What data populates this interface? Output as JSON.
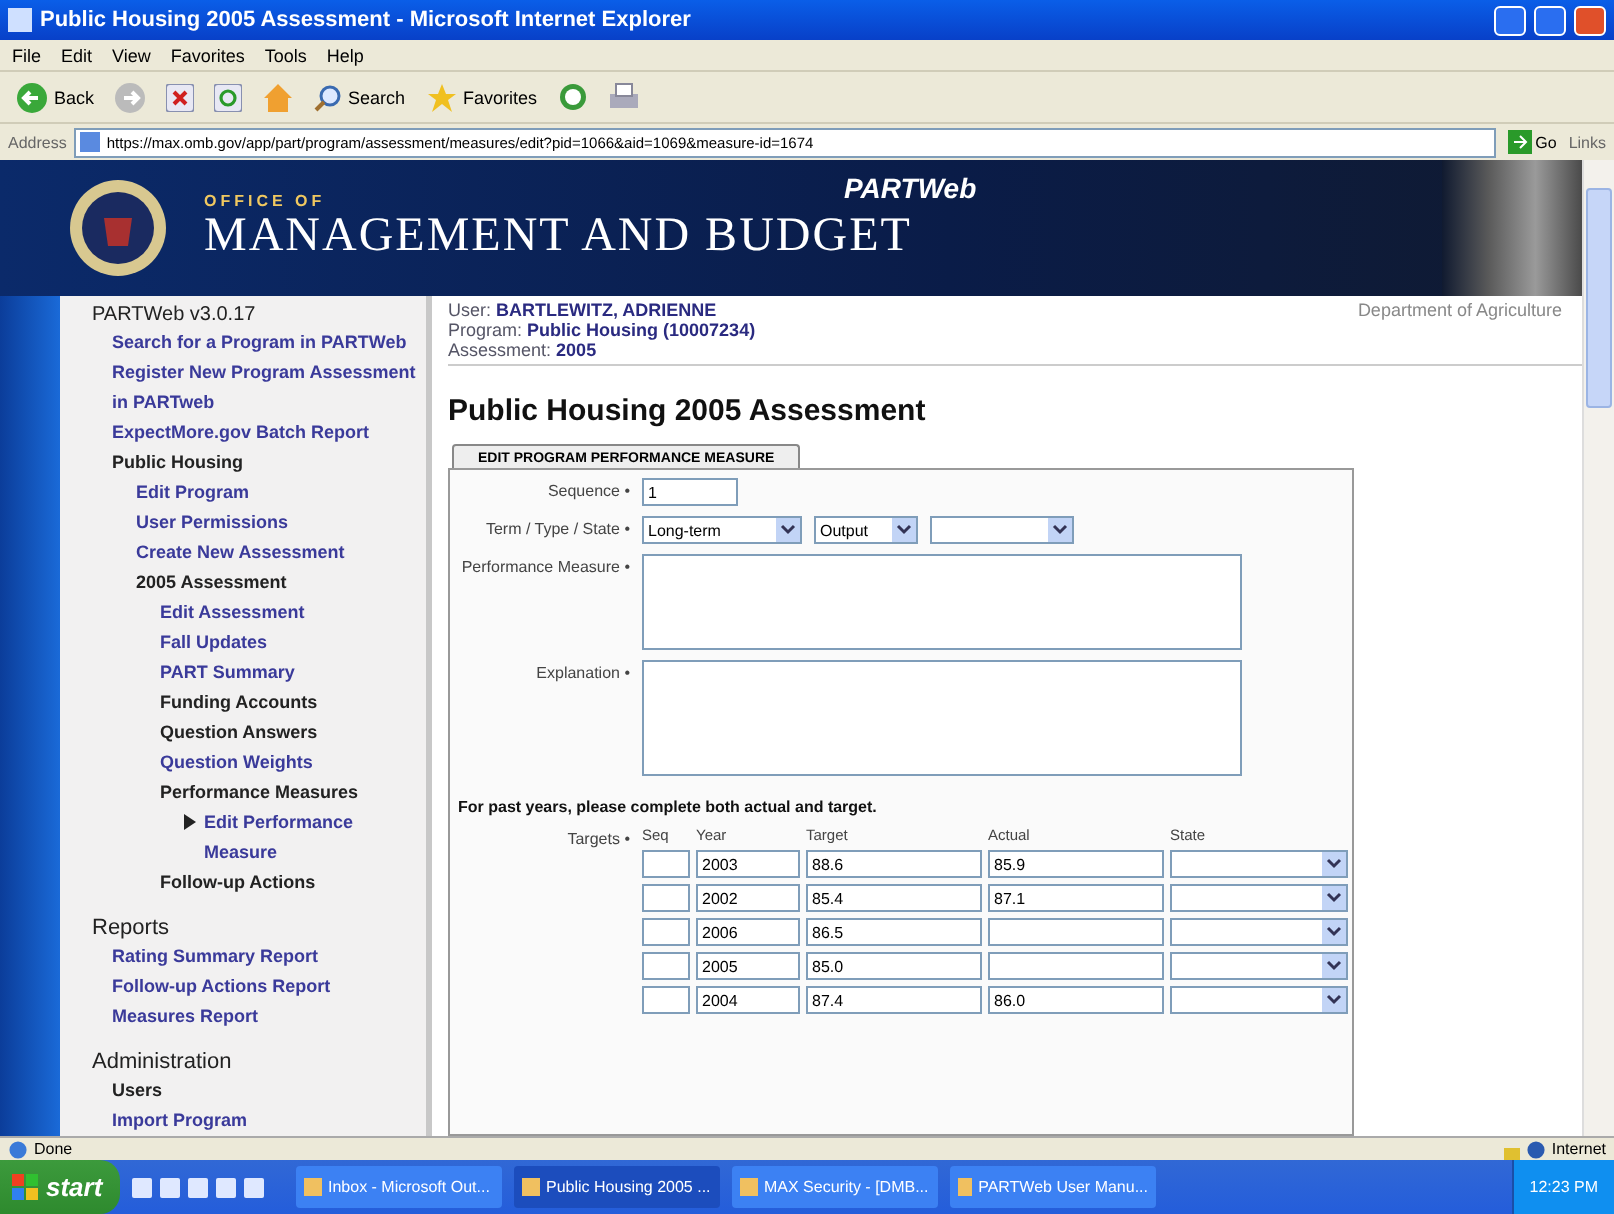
{
  "window": {
    "title": "Public Housing 2005 Assessment - Microsoft Internet Explorer"
  },
  "menu": [
    "File",
    "Edit",
    "View",
    "Favorites",
    "Tools",
    "Help"
  ],
  "toolbar": [
    {
      "kind": "back",
      "label": "Back"
    },
    {
      "kind": "forward"
    },
    {
      "kind": "stop"
    },
    {
      "kind": "refresh"
    },
    {
      "kind": "home"
    },
    {
      "kind": "search",
      "label": "Search"
    },
    {
      "kind": "favorites",
      "label": "Favorites"
    },
    {
      "kind": "history"
    },
    {
      "kind": "print"
    }
  ],
  "address": {
    "label": "Address",
    "url": "https://max.omb.gov/app/part/program/assessment/measures/edit?pid=1066&aid=1069&measure-id=1674",
    "go": "Go",
    "links": "Links"
  },
  "header": {
    "office_of": "OFFICE OF",
    "agency": "MANAGEMENT AND BUDGET",
    "logo": "PARTWeb"
  },
  "sidebar": {
    "sections": [
      {
        "title": "PARTWeb v3.0.17",
        "items": [
          {
            "label": "Search for a Program in PARTWeb",
            "link": true,
            "selected": false
          },
          {
            "label": "Register New Program Assessment in PARTweb",
            "link": true,
            "selected": false
          },
          {
            "label": "ExpectMore.gov Batch Report",
            "link": true,
            "selected": false
          },
          {
            "label": "Public Housing",
            "link": false,
            "selected": false,
            "children": [
              {
                "label": "Edit Program",
                "link": true,
                "selected": false
              },
              {
                "label": "User Permissions",
                "link": true,
                "selected": false
              },
              {
                "label": "Create New Assessment",
                "link": true,
                "selected": false
              },
              {
                "label": "2005 Assessment",
                "link": false,
                "selected": false,
                "children": [
                  {
                    "label": "Edit Assessment",
                    "link": true,
                    "selected": false
                  },
                  {
                    "label": "Fall Updates",
                    "link": true,
                    "selected": false
                  },
                  {
                    "label": "PART Summary",
                    "link": true,
                    "selected": false
                  },
                  {
                    "label": "Funding Accounts",
                    "link": false,
                    "selected": false
                  },
                  {
                    "label": "Question Answers",
                    "link": false,
                    "selected": false
                  },
                  {
                    "label": "Question Weights",
                    "link": true,
                    "selected": false
                  },
                  {
                    "label": "Performance Measures",
                    "link": false,
                    "selected": false,
                    "children": [
                      {
                        "label": "Edit Performance Measure",
                        "link": true,
                        "selected": true
                      }
                    ]
                  },
                  {
                    "label": "Follow-up Actions",
                    "link": false,
                    "selected": false
                  }
                ]
              }
            ]
          }
        ]
      },
      {
        "title": "Reports",
        "items": [
          {
            "label": "Rating Summary Report",
            "link": true,
            "selected": false
          },
          {
            "label": "Follow-up Actions Report",
            "link": true,
            "selected": false
          },
          {
            "label": "Measures Report",
            "link": true,
            "selected": false
          }
        ]
      },
      {
        "title": "Administration",
        "items": [
          {
            "label": "Users",
            "link": false,
            "selected": false
          },
          {
            "label": "Import Program",
            "link": true,
            "selected": false
          }
        ]
      }
    ]
  },
  "info": [
    {
      "label": "User:",
      "value": "BARTLEWITZ, ADRIENNE"
    },
    {
      "label": "Program:",
      "value": "Public Housing (10007234)"
    },
    {
      "label": "Assessment:",
      "value": "2005"
    }
  ],
  "department": "Department of Agriculture",
  "page_title": "Public Housing 2005 Assessment",
  "form": {
    "tab": "EDIT PROGRAM PERFORMANCE MEASURE",
    "sequence": {
      "label": "Sequence •",
      "value": "1"
    },
    "term": {
      "label": "Term / Type / State •",
      "selects": [
        {
          "kind": "dropdown",
          "value": "Long-term"
        },
        {
          "kind": "dropdown",
          "value": "Output"
        },
        {
          "kind": "dropdown"
        }
      ]
    },
    "performance_measure": {
      "label": "Performance Measure •"
    },
    "explanation": {
      "label": "Explanation •"
    },
    "note": "For past years, please complete both actual and target.",
    "targets": {
      "label": "Targets •",
      "columns": [
        "Seq",
        "Year",
        "Target",
        "Actual",
        "State"
      ],
      "rows": [
        {
          "year": "2003",
          "target": "88.6",
          "actual": "85.9"
        },
        {
          "year": "2002",
          "target": "85.4",
          "actual": "87.1"
        },
        {
          "year": "2006",
          "target": "86.5"
        },
        {
          "year": "2005",
          "target": "85.0"
        },
        {
          "year": "2004",
          "target": "87.4",
          "actual": "86.0"
        }
      ]
    }
  },
  "status_bar": {
    "text": "Done",
    "zone": "Internet"
  },
  "taskbar": {
    "start": "start",
    "tasks": [
      {
        "label": "Inbox - Microsoft Out...",
        "selected": false
      },
      {
        "label": "Public Housing 2005 ...",
        "selected": true
      },
      {
        "label": "MAX Security - [DMB...",
        "selected": false
      },
      {
        "label": "PARTWeb User Manu...",
        "selected": false
      }
    ],
    "clock": "12:23 PM"
  }
}
